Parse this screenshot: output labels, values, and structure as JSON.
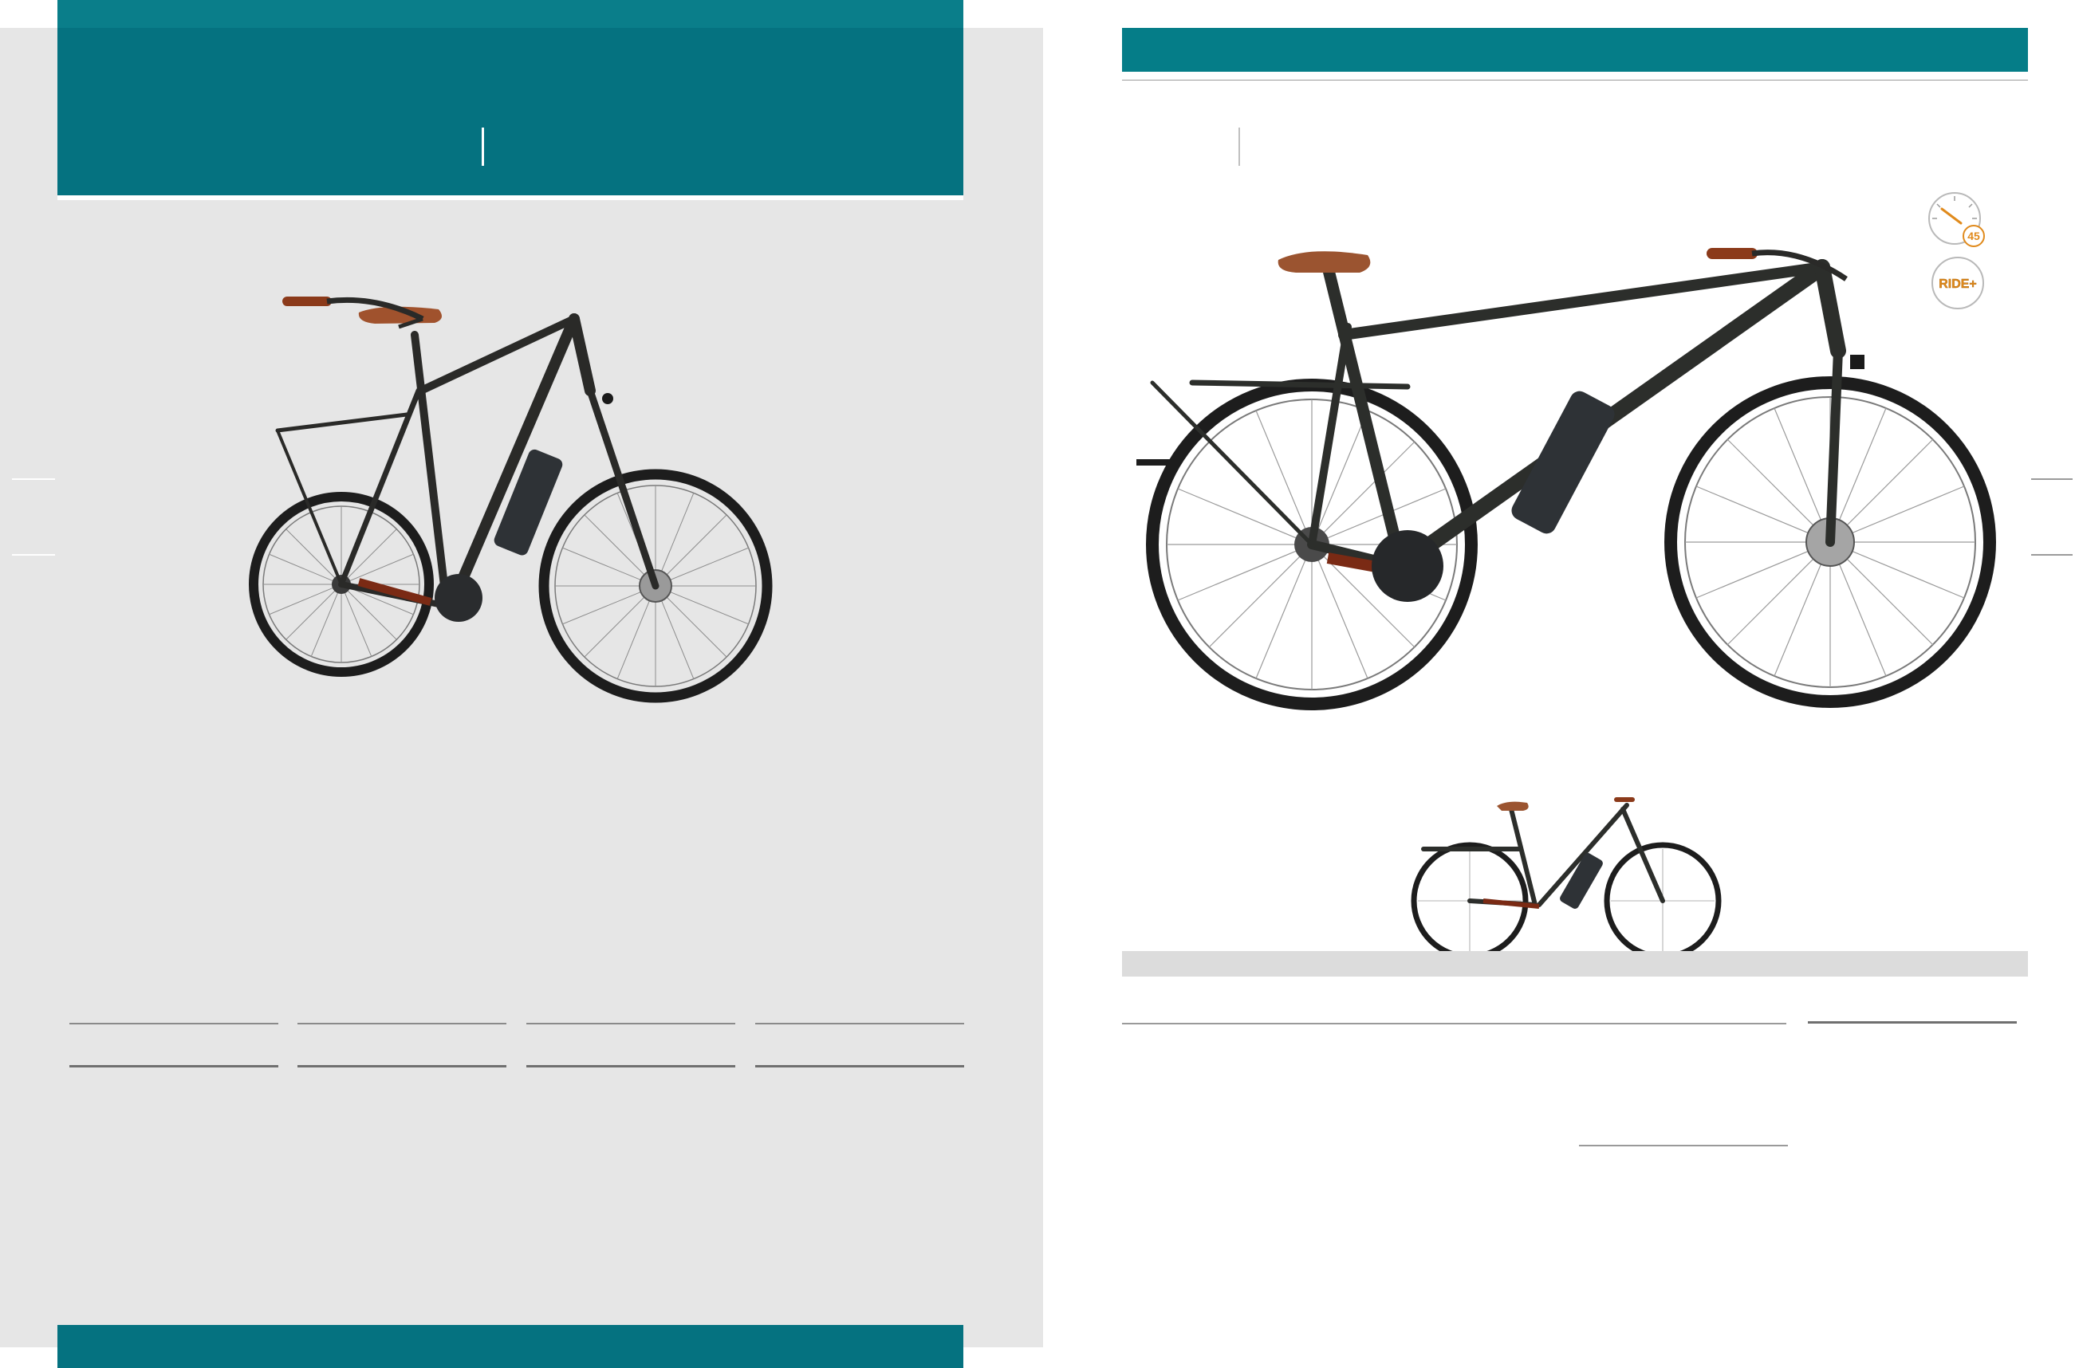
{
  "badges": {
    "speed_value": "45",
    "ride_label": "RIDE+"
  },
  "colors": {
    "teal": "#057280",
    "teal_light": "#0a7e8a",
    "page_gray": "#e6e6e6",
    "badge_orange": "#e08a1c"
  },
  "images": {
    "main_bike": "bike-photo-diamond-frame",
    "large_bike": "bike-photo-diamond-frame-large",
    "small_bike": "bike-photo-step-through"
  }
}
